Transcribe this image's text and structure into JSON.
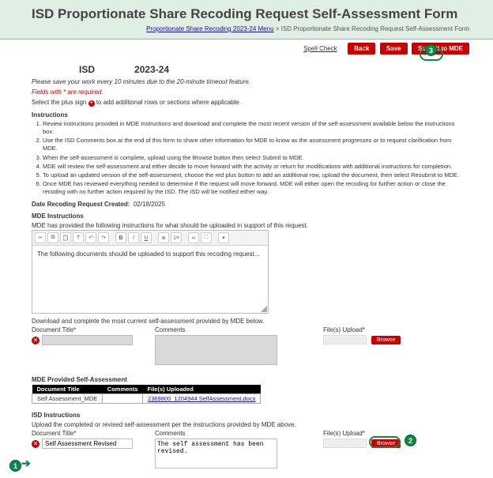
{
  "banner": {
    "title": "ISD Proportionate Share Recoding Request Self-Assessment Form",
    "breadcrumb_link": "Proportionate Share Recoding 2023-24 Menu",
    "breadcrumb_sep": " > ",
    "breadcrumb_current": "ISD Proportionate Share Recoding Request Self-Assessment Form"
  },
  "topbar": {
    "spell": "Spell Check",
    "back": "Back",
    "save": "Save",
    "submit": "Submit to MDE"
  },
  "header": {
    "isd_label": "ISD",
    "year": "2023-24",
    "save_note": "Please save your work every 10 minutes due to the 20-minute timeout feature.",
    "req_note": "Fields with * are required.",
    "plus_note_1": "Select the plus sign ",
    "plus_note_2": " to add additional rows or sections where applicable."
  },
  "instructions": {
    "heading": "Instructions",
    "items": [
      "Review instructions provided in MDE Instructions and download and complete the most recent version of the self-assessment available below the instructions box.",
      "Use the ISD Comments box at the end of this form to share other information for MDE to know as the assessment progresses or to request clarification from MDE.",
      "When the self-assessment is complete, upload using the Browse button then select Submit to MDE.",
      "MDE will review the self-assessment and either decide to move forward with the activity or return for modifications with additional instructions for completion.",
      "To upload an updated version of the self-assessment, choose the red plus button to add an additional row, upload the document, then select Resubmit to MDE.",
      "Once MDE has reviewed everything needed to determine if the request will move forward, MDE will either open the recoding for further action or close the recoding with no further action required by the ISD. The ISD will be notified either way."
    ]
  },
  "date_created": {
    "label": "Date Recoding Request Created:",
    "value": "02/18/2025"
  },
  "mde_instructions": {
    "heading": "MDE Instructions",
    "sub": "MDE has provided the following instructions for what should be uploaded in support of this request.",
    "body": "The following documents should be uploaded to support this recoding request..."
  },
  "download_note": "Download and complete the most current self-assessment provided by MDE below.",
  "mde_row": {
    "doc_label": "Document Title*",
    "comments_label": "Comments",
    "files_label": "File(s) Upload*",
    "browse": "Browse"
  },
  "mde_table": {
    "heading": "MDE Provided Self-Assessment",
    "h1": "Document Title",
    "h2": "Comments",
    "h3": "File(s) Uploaded",
    "c1": "Self Assessment_MDE",
    "c2": "",
    "c3": "2369800_1204944 SelfAssessment.docx"
  },
  "isd_section": {
    "heading": "ISD Instructions",
    "sub": "Upload the completed or revised self-assessment per the instructions provided by MDE above.",
    "doc_label": "Document Title*",
    "comments_label": "Comments",
    "files_label": "File(s) Upload*",
    "doc_value": "Self Assessment Revised",
    "comments_value": "The self assessment has been revised.",
    "browse": "Browse"
  },
  "markers": {
    "m1": "1",
    "m2": "2",
    "m3": "3"
  }
}
